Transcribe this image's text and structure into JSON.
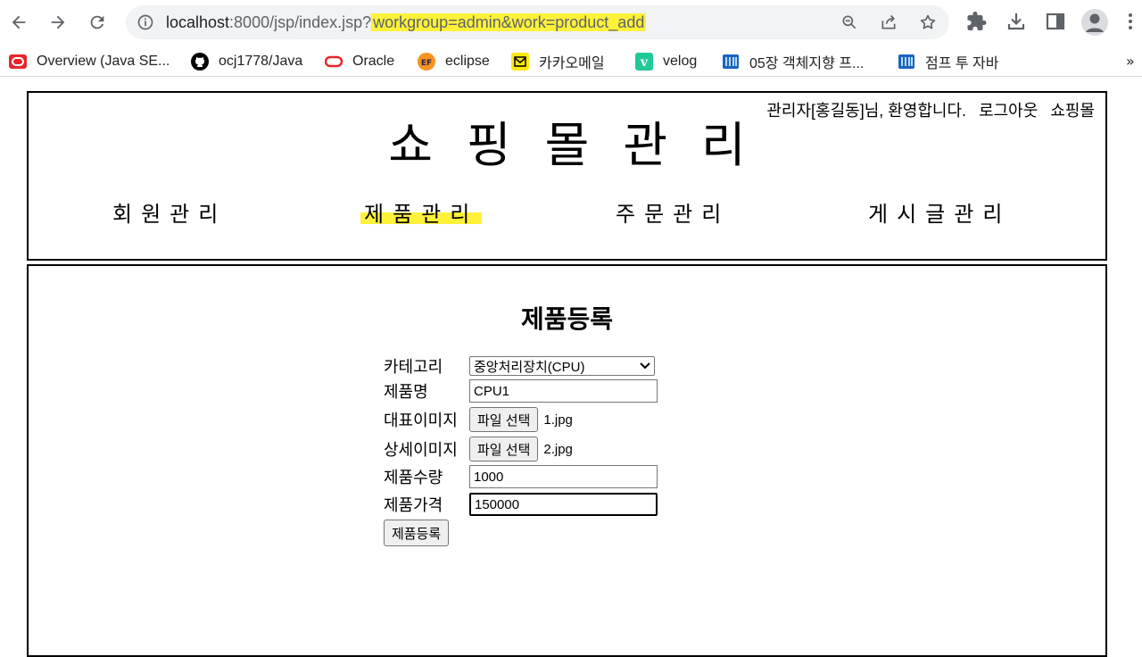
{
  "browser": {
    "url": {
      "host": "localhost",
      "path": ":8000/jsp/index.jsp?",
      "query": "workgroup=admin&work=product_add"
    },
    "bookmarks": [
      {
        "label": "Overview (Java SE...",
        "icon": "oracle-icon",
        "color": "#e8262b"
      },
      {
        "label": "ocj1778/Java",
        "icon": "github-icon",
        "color": "#000000"
      },
      {
        "label": "Oracle",
        "icon": "oracle-ring-icon",
        "color": "#e8262b"
      },
      {
        "label": "eclipse",
        "icon": "eclipse-icon",
        "color": "#f7941e"
      },
      {
        "label": "카카오메일",
        "icon": "kakao-mail-icon",
        "color": "#ffe812"
      },
      {
        "label": "velog",
        "icon": "velog-icon",
        "color": "#20c997"
      },
      {
        "label": "05장 객체지향 프...",
        "icon": "wikidocs-icon",
        "color": "#1565c0"
      },
      {
        "label": "점프 투 자바",
        "icon": "wikidocs-icon",
        "color": "#1565c0"
      }
    ],
    "more_label": "»"
  },
  "header": {
    "greeting": "관리자[홍길동]님, 환영합니다.",
    "logout": "로그아웃",
    "shop": "쇼핑몰",
    "title": "쇼핑몰관리",
    "menu": [
      {
        "label": "회원관리"
      },
      {
        "label": "제품관리"
      },
      {
        "label": "주문관리"
      },
      {
        "label": "게시글관리"
      }
    ]
  },
  "form": {
    "title": "제품등록",
    "category_label": "카테고리",
    "category_value": "중앙처리장치(CPU)",
    "name_label": "제품명",
    "name_value": "CPU1",
    "main_image_label": "대표이미지",
    "main_image_button": "파일 선택",
    "main_image_file": "1.jpg",
    "detail_image_label": "상세이미지",
    "detail_image_button": "파일 선택",
    "detail_image_file": "2.jpg",
    "quantity_label": "제품수량",
    "quantity_value": "1000",
    "price_label": "제품가격",
    "price_value": "150000",
    "submit_label": "제품등록"
  },
  "colors": {
    "highlight": "#fdf13a",
    "border": "#000000",
    "omnibox": "#f1f3f4"
  }
}
